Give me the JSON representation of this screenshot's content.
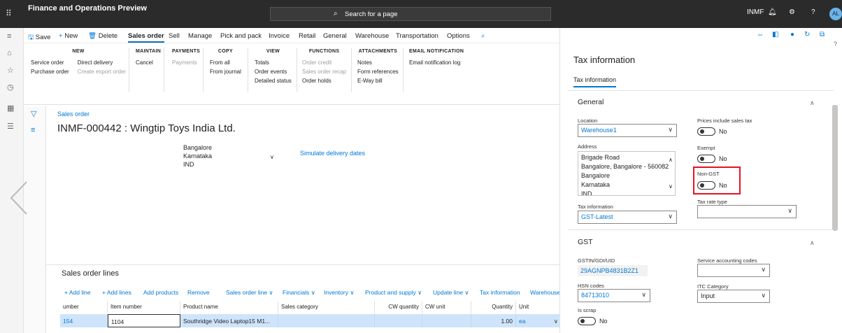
{
  "app": {
    "title": "Finance and Operations Preview",
    "search_placeholder": "Search for a page",
    "company": "INMF",
    "avatar": "AL",
    "help": "?"
  },
  "actionbar": {
    "save": "Save",
    "new": "New",
    "delete": "Delete",
    "tabs": [
      "Sales order",
      "Sell",
      "Manage",
      "Pick and pack",
      "Invoice",
      "Retail",
      "General",
      "Warehouse",
      "Transportation",
      "Options"
    ]
  },
  "ribbon": {
    "new": {
      "header": "NEW",
      "items": [
        "Service order",
        "Purchase order"
      ],
      "items2": [
        "Direct delivery",
        "Create export order"
      ]
    },
    "maintain": {
      "header": "MAINTAIN",
      "items": [
        "Cancel"
      ]
    },
    "payments": {
      "header": "PAYMENTS",
      "items": [
        "Payments"
      ]
    },
    "copy": {
      "header": "COPY",
      "items": [
        "From all",
        "From journal"
      ]
    },
    "view": {
      "header": "VIEW",
      "items": [
        "Totals",
        "Order events",
        "Detailed status"
      ]
    },
    "functions": {
      "header": "FUNCTIONS",
      "items": [
        "Order credit",
        "Sales order recap",
        "Order holds"
      ]
    },
    "attachments": {
      "header": "ATTACHMENTS",
      "items": [
        "Notes",
        "Form references",
        "E-Way bill"
      ]
    },
    "email": {
      "header": "EMAIL NOTIFICATION",
      "items": [
        "Email notification log"
      ]
    }
  },
  "page": {
    "breadcrumb": "Sales order",
    "title": "INMF-000442 : Wingtip Toys India Ltd.",
    "address_lines": [
      "Bangalore",
      "Karnataka",
      "IND"
    ],
    "simulate": "Simulate delivery dates"
  },
  "lines": {
    "title": "Sales order lines",
    "toolbar": [
      "+ Add line",
      "+ Add lines",
      "Add products",
      "Remove",
      "Sales order line ∨",
      "Financials ∨",
      "Inventory ∨",
      "Product and supply ∨",
      "Update line ∨",
      "Tax information",
      "Warehouse"
    ],
    "columns": [
      "umber",
      "Item number",
      "Product name",
      "Sales category",
      "CW quantity",
      "CW unit",
      "Quantity",
      "Unit"
    ],
    "row": {
      "line": "154",
      "item": "1104",
      "product": "Southridge Video Laptop15 M1...",
      "category": "",
      "cwqty": "",
      "cwunit": "",
      "qty": "1.00",
      "unit": "ea"
    }
  },
  "panel": {
    "title": "Tax information",
    "tab": "Tax information",
    "general": {
      "header": "General",
      "location_label": "Location",
      "location_value": "Warehouse1",
      "address_label": "Address",
      "address_lines": [
        "Brigade Road",
        "Bangalore, Bangalore - 560082",
        "Bangalore",
        "Karnataka",
        "IND"
      ],
      "taxinfo_label": "Tax information",
      "taxinfo_value": "GST-Latest",
      "prices_label": "Prices include sales tax",
      "prices_value": "No",
      "exempt_label": "Exempt",
      "exempt_value": "No",
      "nongst_label": "Non-GST",
      "nongst_value": "No",
      "taxrate_label": "Tax rate type",
      "taxrate_value": ""
    },
    "gst": {
      "header": "GST",
      "gstin_label": "GSTIN/GDI/UID",
      "gstin_value": "29AGNPB4831B2Z1",
      "hsn_label": "HSN codes",
      "hsn_value": "84713010",
      "isscrap_label": "Is scrap",
      "isscrap_value": "No",
      "sac_label": "Service accounting codes",
      "sac_value": "",
      "itc_label": "ITC Category",
      "itc_value": "Input"
    }
  }
}
